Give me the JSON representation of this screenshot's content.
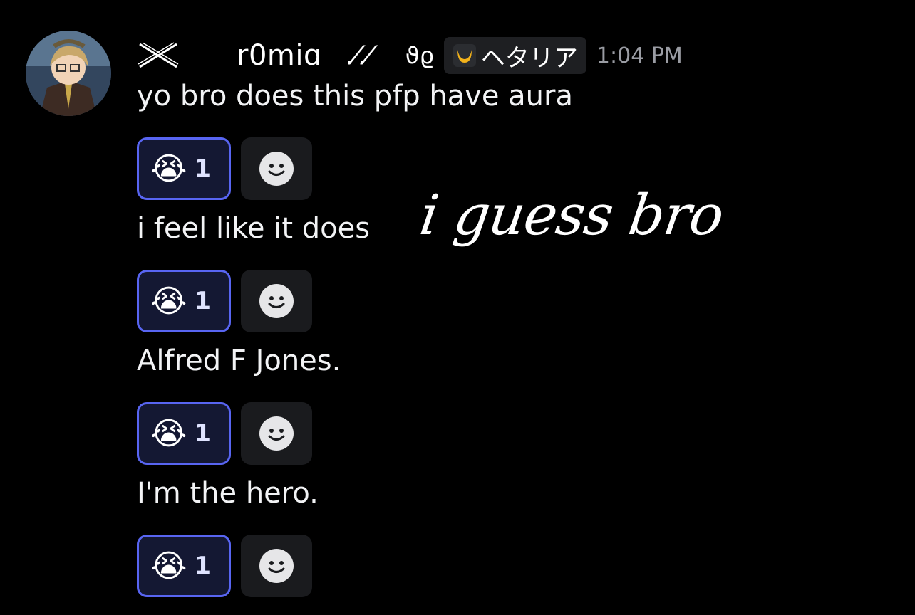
{
  "author": {
    "name": "r0miɑ",
    "decor_a": ".⁄.⁄",
    "decor_b": "ϑϱ",
    "tag_text": "ヘタリア",
    "timestamp": "1:04 PM"
  },
  "messages": [
    {
      "text": "yo bro does this pfp have aura",
      "reaction_emoji": "😭",
      "reaction_count": "1"
    },
    {
      "text": "i feel like it does",
      "reaction_emoji": "😭",
      "reaction_count": "1"
    },
    {
      "text": "Alfred F Jones.",
      "reaction_emoji": "😭",
      "reaction_count": "1"
    },
    {
      "text": "I'm the hero.",
      "reaction_emoji": "😭",
      "reaction_count": "1"
    }
  ],
  "overlay_text": "i guess bro",
  "colors": {
    "background": "#000000",
    "reaction_border": "#5865f2",
    "timestamp": "#9a9ca3"
  },
  "icons": {
    "add_reaction": "smiley-icon",
    "deco": "crossed-swords-icon",
    "tag": "moon-icon"
  }
}
